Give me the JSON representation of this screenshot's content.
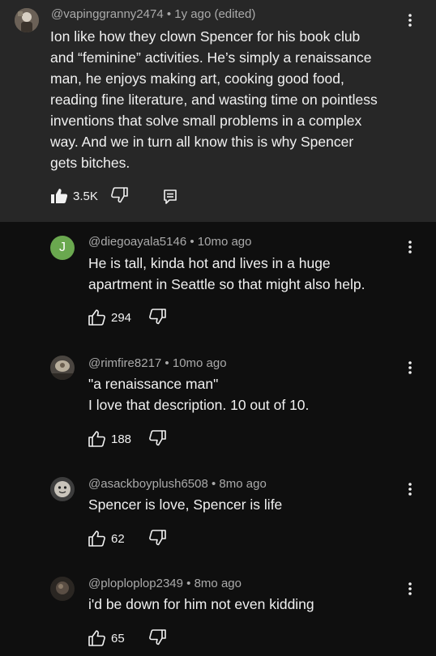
{
  "top_comment": {
    "author": "@vapinggranny2474",
    "time": "1y ago (edited)",
    "lines": [
      "Ion like how they clown Spencer for his book club",
      "and “feminine” activities. He’s simply a renaissance",
      "man, he enjoys making art, cooking good food,",
      "reading fine literature, and wasting time on pointless",
      "inventions that solve small problems in a complex",
      "way. And we in turn all know this is why Spencer",
      "gets bitches."
    ],
    "likes": "3.5K"
  },
  "replies": [
    {
      "author": "@diegoayala5146",
      "time": "10mo ago",
      "avatar_letter": "J",
      "lines": [
        "He is tall, kinda hot and lives in a huge",
        "apartment in Seattle so that might also help."
      ],
      "likes": "294"
    },
    {
      "author": "@rimfire8217",
      "time": "10mo ago",
      "lines": [
        "\"a renaissance man\"",
        "I love that description. 10 out of 10."
      ],
      "likes": "188"
    },
    {
      "author": "@asackboyplush6508",
      "time": "8mo ago",
      "lines": [
        "Spencer is love, Spencer is life"
      ],
      "likes": "62"
    },
    {
      "author": "@ploploplop2349",
      "time": "8mo ago",
      "lines": [
        "i'd be down for him not even kidding"
      ],
      "likes": "65"
    }
  ],
  "separator": " • ",
  "colors": {
    "top_bg": "#272727",
    "page_bg": "#0f0f0f",
    "text": "#f1f1f1",
    "meta": "#aaaaaa",
    "letter_avatar": "#6aa84f"
  },
  "icons": [
    "thumb-up-icon",
    "thumb-down-icon",
    "reply-icon",
    "more-vert-icon"
  ]
}
